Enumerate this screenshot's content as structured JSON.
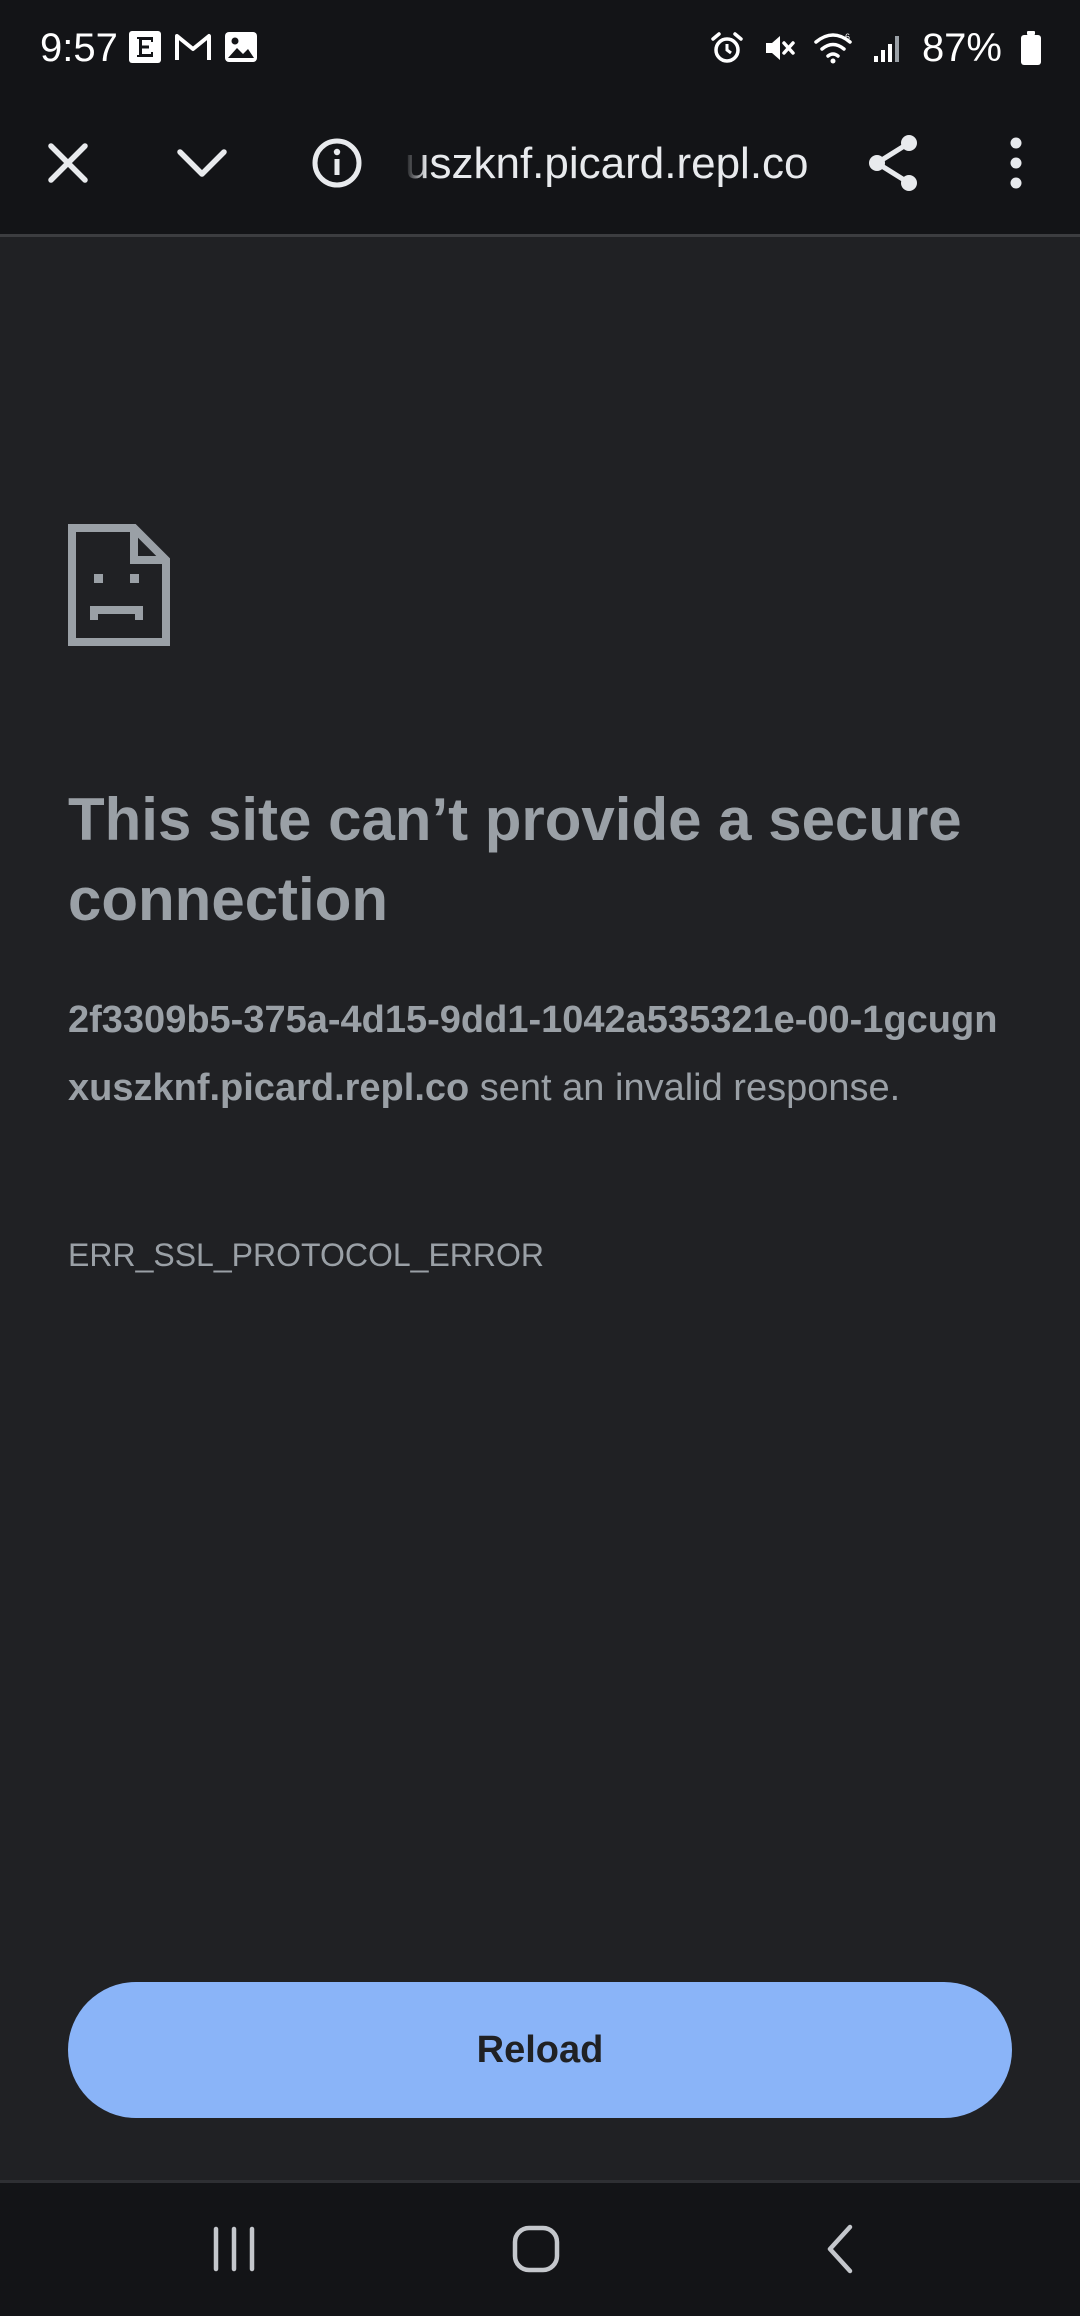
{
  "status_bar": {
    "time": "9:57",
    "battery": "87%",
    "left_icons": [
      "e-app-icon",
      "gmail-icon",
      "gallery-icon"
    ],
    "right_icons": [
      "alarm-icon",
      "mute-icon",
      "wifi-icon",
      "signal-icon",
      "battery-icon"
    ]
  },
  "toolbar": {
    "url": "uszknf.picard.repl.co",
    "icons": [
      "close-icon",
      "chevron-down-icon",
      "info-icon",
      "share-icon",
      "more-vert-icon"
    ]
  },
  "error": {
    "icon": "sad-document-icon",
    "title": "This site can’t provide a secure connection",
    "host": "2f3309b5-375a-4d15-9dd1-1042a535321e-00-1gcugnxuszknf.picard.repl.co",
    "message": " sent an invalid response.",
    "code": "ERR_SSL_PROTOCOL_ERROR"
  },
  "actions": {
    "reload_label": "Reload"
  },
  "nav_bar": {
    "icons": [
      "recent-apps-icon",
      "home-icon",
      "back-icon"
    ]
  },
  "colors": {
    "background": "#202124",
    "bars": "#131417",
    "text_muted": "#9aa0a6",
    "accent": "#8ab4f8"
  }
}
